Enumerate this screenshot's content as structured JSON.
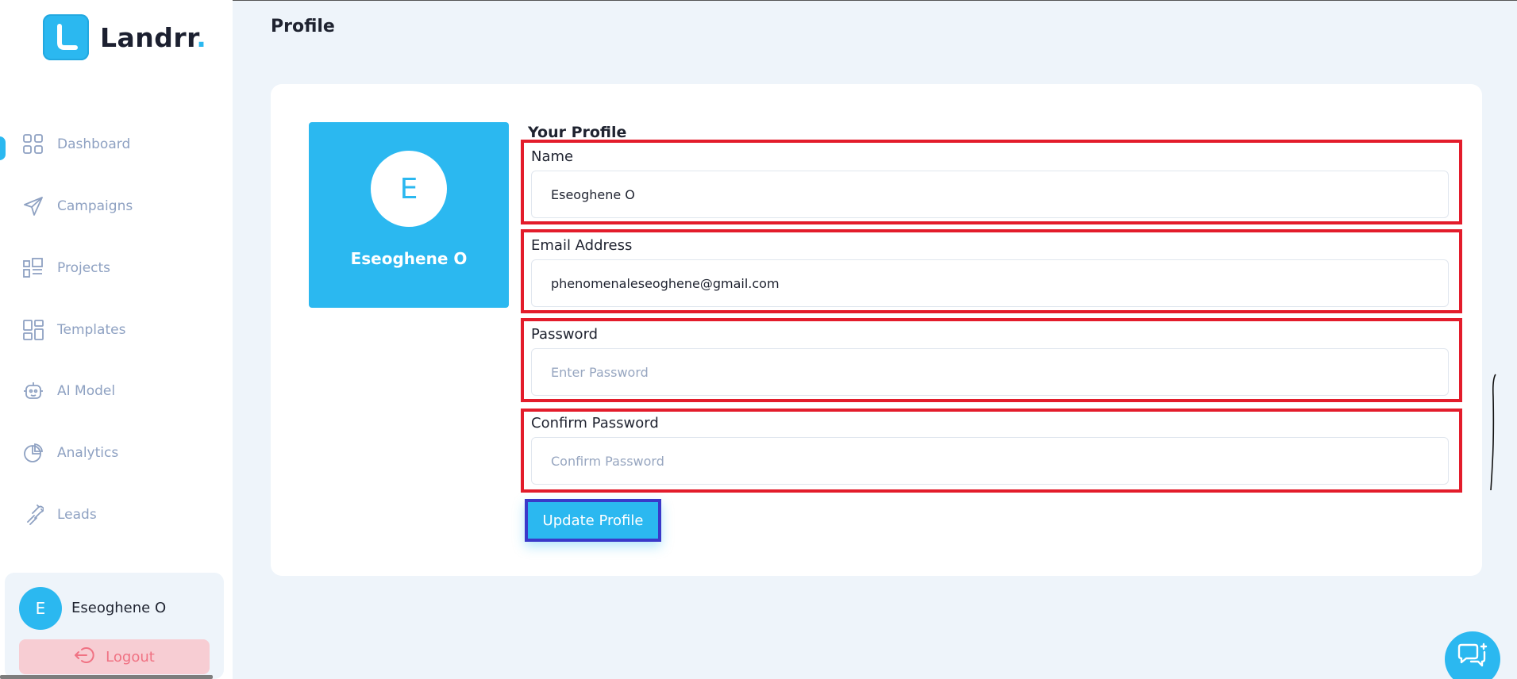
{
  "brand": {
    "name": "Landrr",
    "dot": "."
  },
  "page": {
    "title": "Profile"
  },
  "sidebar": {
    "items": [
      {
        "label": "Dashboard",
        "icon": "grid-icon"
      },
      {
        "label": "Campaigns",
        "icon": "paper-plane-icon"
      },
      {
        "label": "Projects",
        "icon": "blueprint-icon"
      },
      {
        "label": "Templates",
        "icon": "template-layout-icon"
      },
      {
        "label": "AI Model",
        "icon": "robot-icon"
      },
      {
        "label": "Analytics",
        "icon": "pie-chart-icon"
      },
      {
        "label": "Leads",
        "icon": "magnet-icon"
      }
    ],
    "user": {
      "initial": "E",
      "name": "Eseoghene O"
    },
    "logout_label": "Logout"
  },
  "profile": {
    "initial": "E",
    "name": "Eseoghene O",
    "section_title": "Your Profile",
    "fields": {
      "name": {
        "label": "Name",
        "value": "Eseoghene O",
        "placeholder": ""
      },
      "email": {
        "label": "Email Address",
        "value": "phenomenaleseoghene@gmail.com",
        "placeholder": ""
      },
      "password": {
        "label": "Password",
        "value": "",
        "placeholder": "Enter Password"
      },
      "confirm": {
        "label": "Confirm Password",
        "value": "",
        "placeholder": "Confirm Password"
      }
    },
    "update_label": "Update Profile"
  },
  "colors": {
    "accent": "#2bb8f0",
    "nav_text": "#8ea1c2",
    "highlight_red": "#e31c2b",
    "highlight_blue": "#3a39c9",
    "logout_bg": "#f7cdd3",
    "logout_text": "#f07283"
  }
}
